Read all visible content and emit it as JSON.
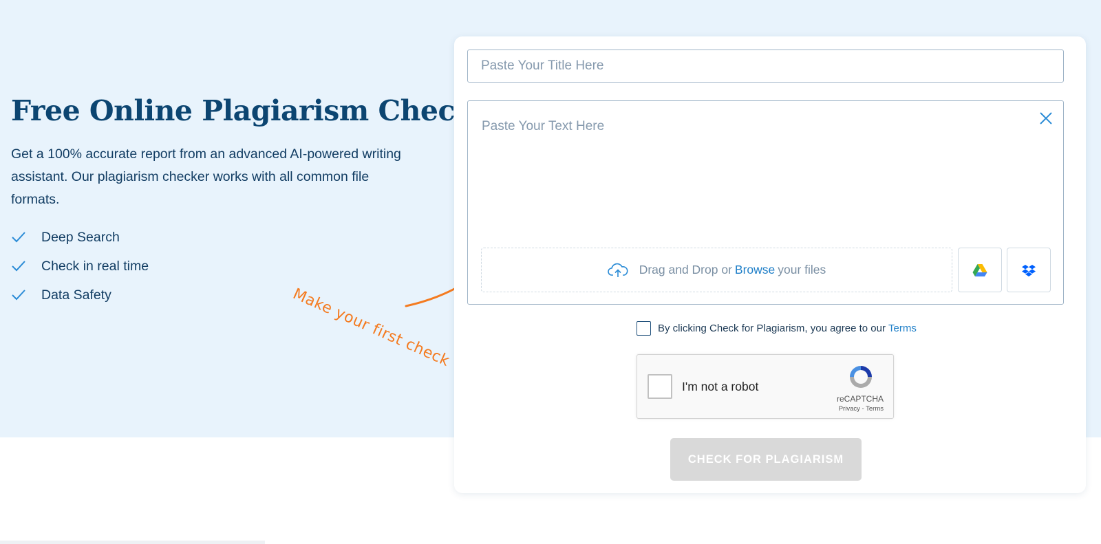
{
  "hero": {
    "title": "Free Online Plagiarism Checker",
    "subtitle": "Get a 100% accurate report from an advanced AI-powered writing assistant. Our plagiarism checker works with all common file formats.",
    "features": [
      "Deep Search",
      "Check in real time",
      "Data Safety"
    ]
  },
  "hint": {
    "text": "Make your first check"
  },
  "form": {
    "title_placeholder": "Paste Your Title Here",
    "title_value": "",
    "text_placeholder": "Paste Your Text Here",
    "text_value": "",
    "dropzone": {
      "prefix": "Drag and Drop or",
      "browse": "Browse",
      "suffix": "your files"
    },
    "terms": {
      "text": "By clicking Check for Plagiarism, you agree to our",
      "link": "Terms",
      "checked": false
    },
    "recaptcha": {
      "label": "I'm not a robot",
      "brand": "reCAPTCHA",
      "links": "Privacy - Terms"
    },
    "submit_label": "CHECK FOR PLAGIARISM"
  },
  "colors": {
    "hero_bg": "#e8f3fc",
    "title": "#0c4571",
    "accent": "#1f7fc8",
    "hint": "#f47b20",
    "button_disabled": "#d9d9d9"
  },
  "icons": [
    "check-icon",
    "close-icon",
    "upload-cloud-icon",
    "google-drive-icon",
    "dropbox-icon",
    "recaptcha-logo-icon",
    "curved-arrow-icon"
  ]
}
